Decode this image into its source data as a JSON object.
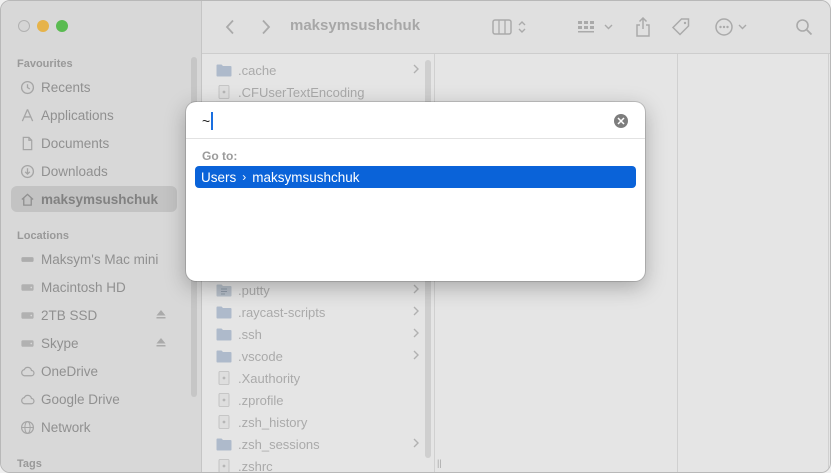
{
  "window": {
    "title": "maksymsushchuk"
  },
  "sidebar": {
    "sections": [
      {
        "title": "Favourites",
        "items": [
          {
            "label": "Recents",
            "icon": "clock-icon",
            "active": false
          },
          {
            "label": "Applications",
            "icon": "applications-icon",
            "active": false
          },
          {
            "label": "Documents",
            "icon": "document-icon",
            "active": false
          },
          {
            "label": "Downloads",
            "icon": "download-icon",
            "active": false
          },
          {
            "label": "maksymsushchuk",
            "icon": "home-icon",
            "active": true
          }
        ]
      },
      {
        "title": "Locations",
        "items": [
          {
            "label": "Maksym's Mac mini",
            "icon": "computer-icon",
            "active": false
          },
          {
            "label": "Macintosh HD",
            "icon": "drive-icon",
            "active": false
          },
          {
            "label": "2TB SSD",
            "icon": "drive-icon",
            "active": false,
            "eject": true
          },
          {
            "label": "Skype",
            "icon": "drive-icon",
            "active": false,
            "eject": true
          },
          {
            "label": "OneDrive",
            "icon": "cloud-icon",
            "active": false
          },
          {
            "label": "Google Drive",
            "icon": "cloud-icon",
            "active": false
          },
          {
            "label": "Network",
            "icon": "globe-icon",
            "active": false
          }
        ]
      },
      {
        "title": "Tags",
        "items": []
      }
    ]
  },
  "files_top": [
    {
      "name": ".cache",
      "type": "folder",
      "chevron": true
    },
    {
      "name": ".CFUserTextEncoding",
      "type": "file",
      "chevron": false
    }
  ],
  "files_bottom": [
    {
      "name": ".putty",
      "type": "folder-alias",
      "chevron": true
    },
    {
      "name": ".raycast-scripts",
      "type": "folder",
      "chevron": true
    },
    {
      "name": ".ssh",
      "type": "folder",
      "chevron": true
    },
    {
      "name": ".vscode",
      "type": "folder",
      "chevron": true
    },
    {
      "name": ".Xauthority",
      "type": "file",
      "chevron": false
    },
    {
      "name": ".zprofile",
      "type": "file",
      "chevron": false
    },
    {
      "name": ".zsh_history",
      "type": "file",
      "chevron": false
    },
    {
      "name": ".zsh_sessions",
      "type": "folder",
      "chevron": true
    },
    {
      "name": ".zshrc",
      "type": "file",
      "chevron": false
    }
  ],
  "column_resize_glyph": "||",
  "dialog": {
    "input_value": "~",
    "goto_label": "Go to:",
    "suggestion": {
      "parts": [
        "Users",
        "maksymsushchuk"
      ],
      "separator": "›"
    }
  },
  "colors": {
    "accent": "#0a63d9",
    "traffic_min": "#f5bf4f",
    "traffic_max": "#60c757"
  }
}
